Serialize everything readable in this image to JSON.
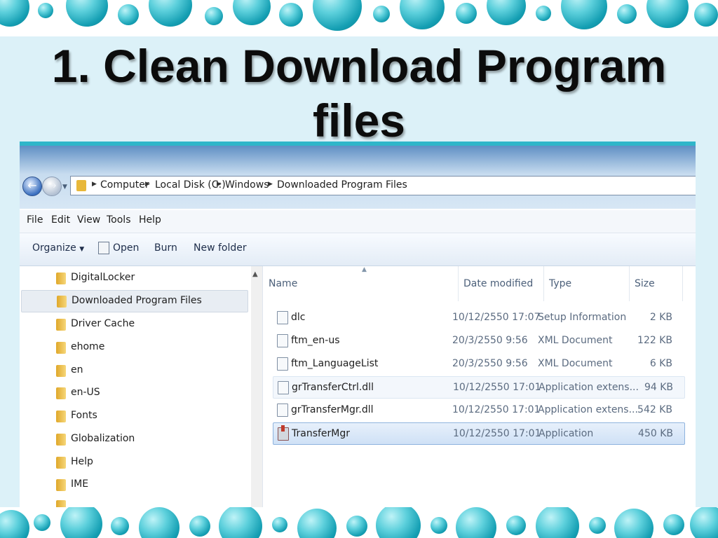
{
  "slide": {
    "title_line1": "1. Clean Download Program",
    "title_line2": "files"
  },
  "colors": {
    "accent_bubble": "#159fb3",
    "title_panel": "#dcf1f8",
    "selection": "#cfe1f6"
  },
  "explorer": {
    "nav": {
      "back_icon": "back-arrow-icon",
      "forward_icon": "forward-arrow-icon",
      "breadcrumbs": [
        "Computer",
        "Local Disk (C:)",
        "Windows",
        "Downloaded Program Files"
      ]
    },
    "menu": [
      "File",
      "Edit",
      "View",
      "Tools",
      "Help"
    ],
    "toolbar": {
      "organize": "Organize",
      "open": "Open",
      "burn": "Burn",
      "new_folder": "New folder"
    },
    "tree": [
      "DigitalLocker",
      "Downloaded Program Files",
      "Driver Cache",
      "ehome",
      "en",
      "en-US",
      "Fonts",
      "Globalization",
      "Help",
      "IME"
    ],
    "tree_selected": "Downloaded Program Files",
    "columns": {
      "name": "Name",
      "date": "Date modified",
      "type": "Type",
      "size": "Size"
    },
    "files": [
      {
        "name": "dlc",
        "date": "10/12/2550 17:07",
        "type": "Setup Information",
        "size": "2 KB"
      },
      {
        "name": "ftm_en-us",
        "date": "20/3/2550 9:56",
        "type": "XML Document",
        "size": "122 KB"
      },
      {
        "name": "ftm_LanguageList",
        "date": "20/3/2550 9:56",
        "type": "XML Document",
        "size": "6 KB"
      },
      {
        "name": "grTransferCtrl.dll",
        "date": "10/12/2550 17:01",
        "type": "Application extens...",
        "size": "94 KB"
      },
      {
        "name": "grTransferMgr.dll",
        "date": "10/12/2550 17:01",
        "type": "Application extens...",
        "size": "542 KB"
      },
      {
        "name": "TransferMgr",
        "date": "10/12/2550 17:01",
        "type": "Application",
        "size": "450 KB"
      }
    ],
    "file_selected": "TransferMgr"
  }
}
